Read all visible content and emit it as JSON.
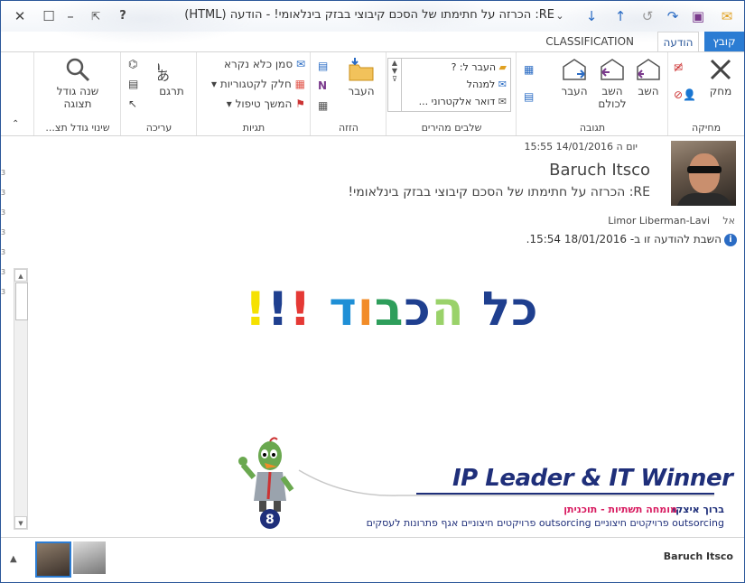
{
  "window": {
    "title": "RE: הכרזה על חתימתו של הסכם קיבוצי בבזק בינלאומי! - הודעה (HTML)"
  },
  "tabs": {
    "file": "קובץ",
    "message": "הודעה",
    "classification": "CLASSIFICATION"
  },
  "ribbon": {
    "delete_group": {
      "label": "מחיקה",
      "delete": "מחק"
    },
    "respond_group": {
      "label": "תגובה",
      "reply": "השב",
      "reply_all": "השב לכולם",
      "forward": "העבר"
    },
    "quick_steps": {
      "label": "שלבים מהירים",
      "items": [
        "העבר ל: ?",
        "למנהל",
        "דואר אלקטרוני ..."
      ]
    },
    "move_group": {
      "label": "הזזה",
      "move": "העבר"
    },
    "tags_group": {
      "label": "תגיות",
      "mark_unread": "סמן כלא נקרא",
      "categorize": "חלק לקטגוריות",
      "follow_up": "המשך טיפול"
    },
    "editing_group": {
      "label": "עריכה",
      "translate": "תרגם"
    },
    "zoom_group": {
      "label": "שינוי גודל תצ...",
      "zoom": "שנה גודל תצוגה"
    }
  },
  "header": {
    "date": "יום ה 14/01/2016 15:55",
    "sender": "Baruch Itsco",
    "subject": "RE: הכרזה על חתימתו של הסכם קיבוצי בבזק בינלאומי!",
    "to_label": "אל",
    "to_value": "Limor Liberman-Lavi",
    "info": "השבת להודעה זו ב- 18/01/2016 15:54."
  },
  "body": {
    "greeting_words": [
      {
        "text": "כל",
        "color": "#1f3f8f"
      },
      {
        "text": " ",
        "color": "#000000"
      },
      {
        "text": "ה",
        "color": "#9ad26a"
      },
      {
        "text": "כ",
        "color": "#1f3f8f"
      },
      {
        "text": "ב",
        "color": "#2e9e5b"
      },
      {
        "text": "ו",
        "color": "#f28c28"
      },
      {
        "text": "ד",
        "color": "#1f8fd6"
      },
      {
        "text": " ",
        "color": "#000000"
      },
      {
        "text": "!",
        "color": "#e53935"
      },
      {
        "text": "!",
        "color": "#1f3f8f"
      },
      {
        "text": "!",
        "color": "#f5e100"
      }
    ],
    "logo": "IP Leader & IT Winner",
    "sig_name": "ברוך איצקו",
    "sig_role": "מומחה תשתיות - תוכניתן",
    "sig_line": "outsorcing פרויקטים חיצוניים  outsorcing פרויקטים חיצוניים  אגף פתרונות לעסקים"
  },
  "people_pane": {
    "name": "Baruch Itsco"
  }
}
